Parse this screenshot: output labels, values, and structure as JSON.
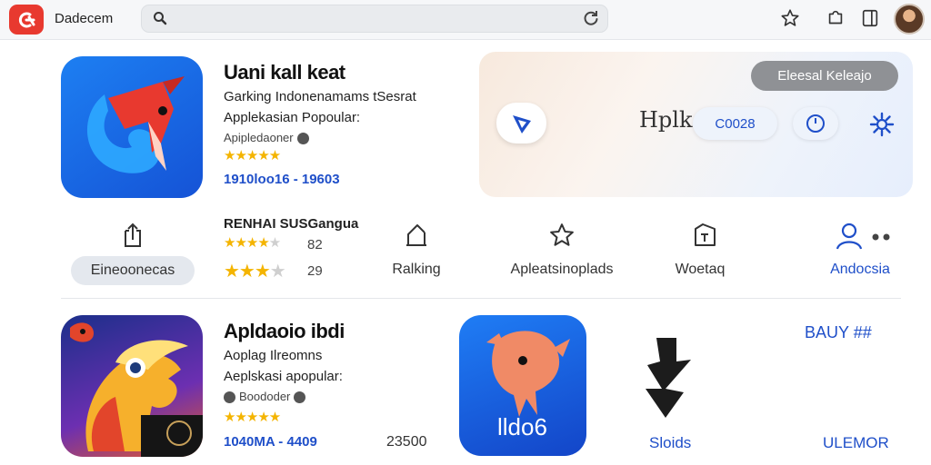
{
  "topbar": {
    "app_name": "Dadecem",
    "search_placeholder": ""
  },
  "featured": {
    "title": "Uani kall keat",
    "line1": "Garking Indonenamams tSesrat",
    "line2": "Applekasian Popoular:",
    "developer": "Apipledaoner",
    "rating_stars": 4.5,
    "meta": "1910loo16 - 19603"
  },
  "banner": {
    "button_label": "Eleesal Keleajo",
    "center_text": "Hplk",
    "pill_label": "C0028"
  },
  "ranking": {
    "heading": "RENHAI SUSGangua",
    "row1_stars": 4.5,
    "row1_count": "82",
    "row2_stars": 3.5,
    "row2_count": "29"
  },
  "categories": {
    "pill_label": "Eineoonecas",
    "items": [
      {
        "label": "Ralking"
      },
      {
        "label": "Apleatsinoplads"
      },
      {
        "label": "Woetaq"
      },
      {
        "label": "Andocsia"
      }
    ]
  },
  "second": {
    "title": "Apldaoio ibdi",
    "line1": "Aoplag Ilreomns",
    "line2": "Aeplskasi apopular:",
    "developer": "Boododer",
    "rating_stars": 4.5,
    "meta": "1040MA - 4409",
    "price": "23500",
    "icon3_text": "lldo6",
    "right_top": "BAUY ##",
    "center_label": "Sloids",
    "right_bottom": "ULEMOR"
  },
  "colors": {
    "accent_blue": "#1f4fc9",
    "star_gold": "#f4b400",
    "logo_red": "#e8392f"
  }
}
